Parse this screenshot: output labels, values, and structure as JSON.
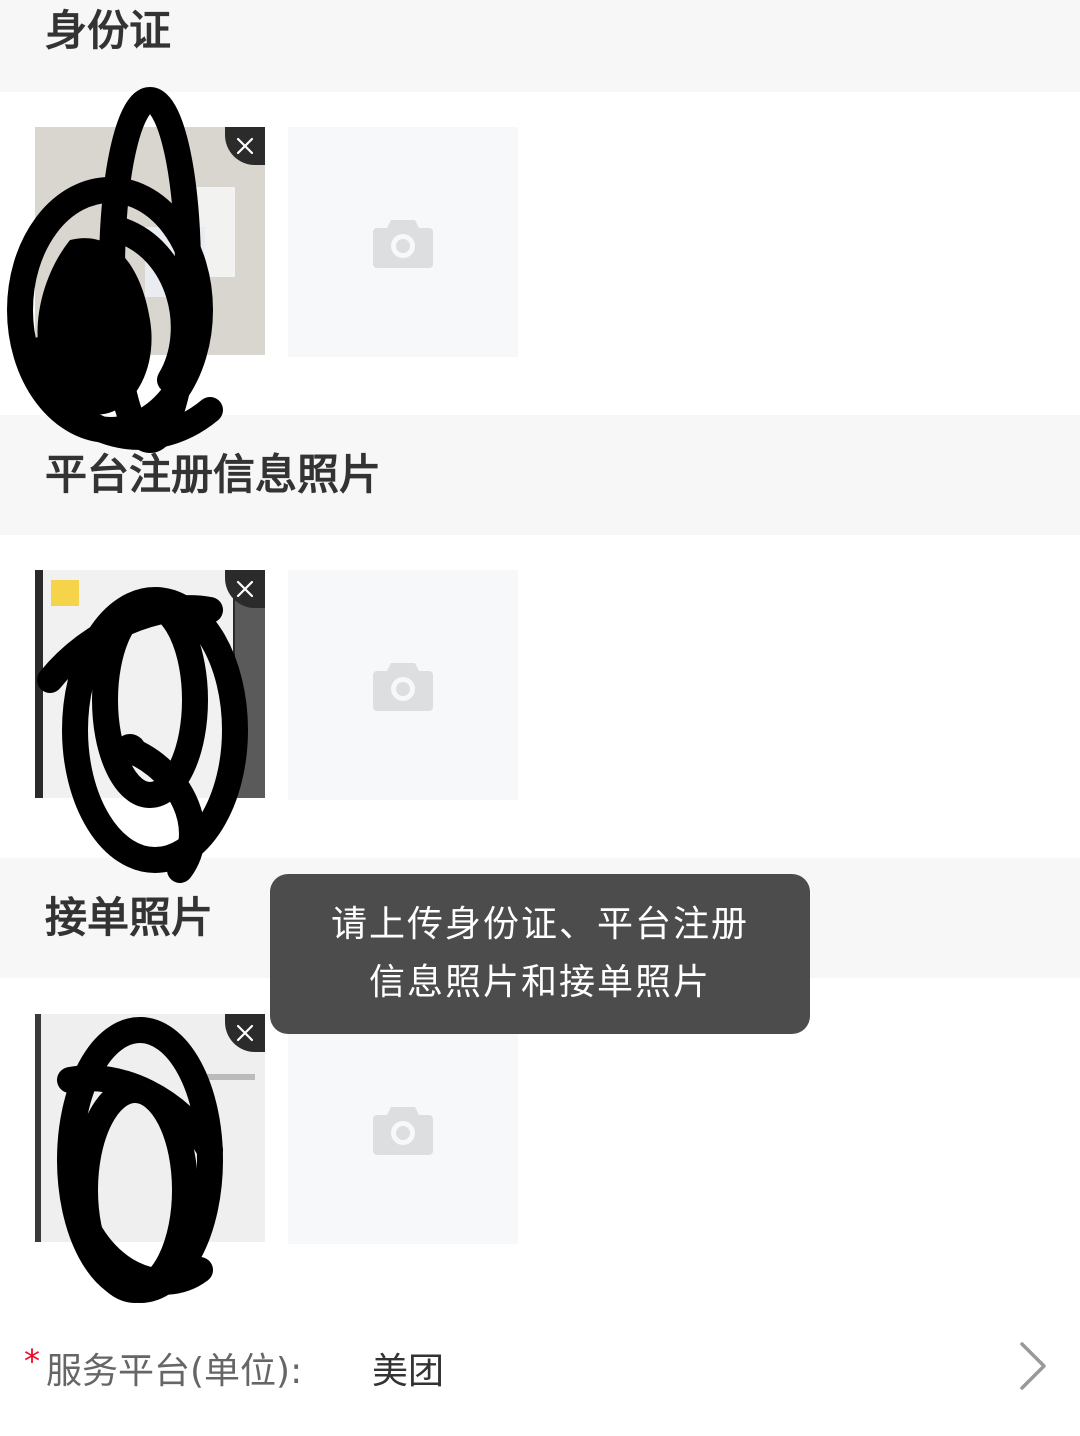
{
  "sections": [
    {
      "title": "身份证"
    },
    {
      "title": "平台注册信息照片"
    },
    {
      "title": "接单照片"
    }
  ],
  "toast": {
    "line1": "请上传身份证、平台注册",
    "line2": "信息照片和接单照片"
  },
  "service_platform": {
    "required_mark": "*",
    "label": "服务平台(单位):",
    "value": "美团"
  },
  "icons": {
    "delete": "close-icon",
    "uploader": "camera-icon",
    "arrow": "chevron-right-icon"
  },
  "colors": {
    "required": "#ee0a24",
    "toast_bg": "#4c4c4c",
    "header_bg": "#f7f7f7"
  }
}
